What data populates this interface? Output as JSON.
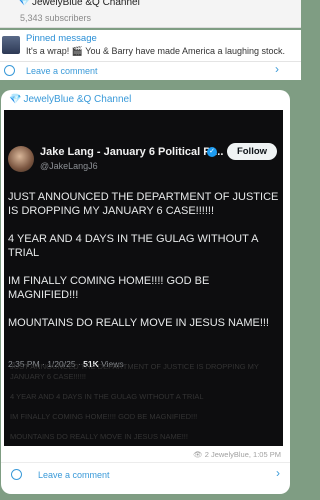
{
  "header": {
    "channel_icon": "diamond-icon",
    "title": "JewelyBlue &Q Channel",
    "subscribers": "5,343 subscribers"
  },
  "pinned": {
    "label": "Pinned message",
    "text": "It's a wrap! 🎬 You & Barry have made America a laughing stock."
  },
  "leave_comment_top": "Leave a comment",
  "post": {
    "channel_name": "JewelyBlue &Q Channel",
    "tweet": {
      "name": "Jake Lang - January 6 Political Pr...",
      "handle": "@JakeLangJ6",
      "follow_label": "Follow",
      "paragraphs": [
        "JUST ANNOUNCED THE DEPARTMENT OF JUSTICE IS DROPPING MY JANUARY 6 CASE!!!!!!",
        "4 YEAR AND 4 DAYS IN THE GULAG WITHOUT A TRIAL",
        "IM FINALLY COMING HOME!!!! GOD BE MAGNIFIED!!!",
        "MOUNTAINS DO REALLY MOVE IN JESUS NAME!!!"
      ],
      "time": "2:35 PM · 1/20/25 · ",
      "views": "51K",
      "views_label": " Views"
    },
    "copy_paragraphs": [
      "JUST ANNOUNCED THE DEPARTMENT OF JUSTICE IS DROPPING MY JANUARY 6 CASE!!!!!!",
      "4 YEAR AND 4 DAYS IN THE GULAG WITHOUT A TRIAL",
      "IM FINALLY COMING HOME!!!! GOD BE MAGNIFIED!!!",
      "MOUNTAINS DO REALLY MOVE IN JESUS NAME!!!"
    ],
    "views_count": "2",
    "footer_meta": "JewelyBlue, 1:05 PM",
    "leave_comment": "Leave a comment"
  },
  "colors": {
    "accent": "#3a9ad9",
    "background": "#7f9d83",
    "tweet_bg": "#0d0d0f"
  }
}
